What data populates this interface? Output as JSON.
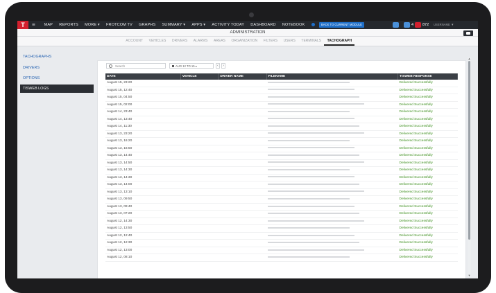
{
  "app": {
    "logo_text": "T"
  },
  "topnav": {
    "items": [
      "MAP",
      "REPORTS",
      "MORE ▾",
      "FROTCOM TV",
      "GRAPHS",
      "SUMMARY ▾",
      "APPS ▾",
      "ACTIVITY TODAY",
      "DASHBOARD",
      "NOTEBOOK"
    ],
    "back_button": "BACK TO CURRENT MODULE",
    "message_count": "4",
    "alert_count": "872",
    "username": "USERNAME",
    "colors": {
      "bar": "#25282d",
      "logo": "#d3202e",
      "accent": "#1f6fc9",
      "alert": "#d3202e"
    }
  },
  "header": {
    "title": "ADMINISTRATION"
  },
  "tabs": [
    "ACCOUNT",
    "VEHICLES",
    "DRIVERS",
    "ALARMS",
    "AREAS",
    "ORGANIZATION",
    "FILTERS",
    "USERS",
    "TERMINALS",
    "TACHOGRAPH"
  ],
  "active_tab": "TACHOGRAPH",
  "sidebar": {
    "items": [
      "TACHOGRAPHS",
      "DRIVERS",
      "OPTIONS",
      "TISWEB LOGS"
    ],
    "active": "TISWEB LOGS"
  },
  "toolbar": {
    "search_placeholder": "Search",
    "filter_label": "AUG 12 TO 15",
    "prev": "‹",
    "next": "›"
  },
  "table": {
    "columns": [
      "DATE",
      "VEHICLE",
      "DRIVER NAME",
      "FILENAME",
      "TISWEB RESPONSE"
    ],
    "rows": [
      {
        "date": "August 15, 23:20",
        "response": "Delivered Successfully"
      },
      {
        "date": "August 15, 12:40",
        "response": "Delivered Successfully"
      },
      {
        "date": "August 15, 04:50",
        "response": "Delivered Successfully"
      },
      {
        "date": "August 15, 02:00",
        "response": "Delivered Successfully"
      },
      {
        "date": "August 14, 23:40",
        "response": "Delivered Successfully"
      },
      {
        "date": "August 14, 13:40",
        "response": "Delivered Successfully"
      },
      {
        "date": "August 14, 11:30",
        "response": "Delivered Successfully"
      },
      {
        "date": "August 13, 23:20",
        "response": "Delivered Successfully"
      },
      {
        "date": "August 13, 16:20",
        "response": "Delivered Successfully"
      },
      {
        "date": "August 13, 16:50",
        "response": "Delivered Successfully"
      },
      {
        "date": "August 13, 14:40",
        "response": "Delivered Successfully"
      },
      {
        "date": "August 13, 14:50",
        "response": "Delivered Successfully"
      },
      {
        "date": "August 13, 14:30",
        "response": "Delivered Successfully"
      },
      {
        "date": "August 13, 14:30",
        "response": "Delivered Successfully"
      },
      {
        "date": "August 13, 14:00",
        "response": "Delivered Successfully"
      },
      {
        "date": "August 13, 13:10",
        "response": "Delivered Successfully"
      },
      {
        "date": "August 13, 09:50",
        "response": "Delivered Successfully"
      },
      {
        "date": "August 13, 09:40",
        "response": "Delivered Successfully"
      },
      {
        "date": "August 13, 07:20",
        "response": "Delivered Successfully"
      },
      {
        "date": "August 12, 14:30",
        "response": "Delivered Successfully"
      },
      {
        "date": "August 12, 13:50",
        "response": "Delivered Successfully"
      },
      {
        "date": "August 12, 12:40",
        "response": "Delivered Successfully"
      },
      {
        "date": "August 12, 12:30",
        "response": "Delivered Successfully"
      },
      {
        "date": "August 12, 13:00",
        "response": "Delivered Successfully"
      },
      {
        "date": "August 12, 08:10",
        "response": "Delivered Successfully"
      }
    ],
    "colors": {
      "header_bg": "#3b3f45",
      "response": "#3a8d1a"
    }
  }
}
